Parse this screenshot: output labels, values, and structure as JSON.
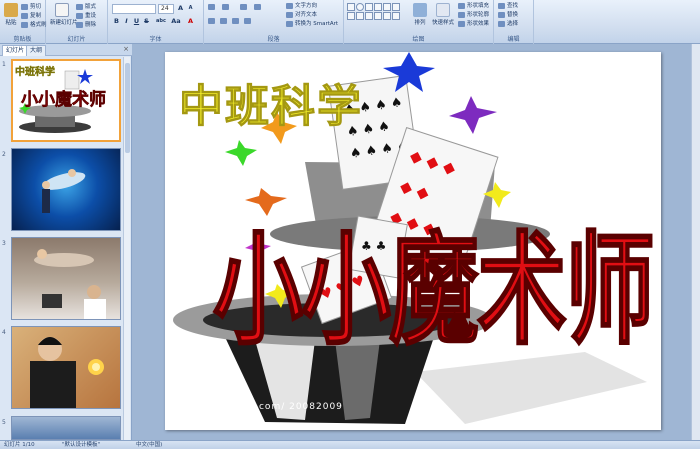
{
  "ribbon": {
    "clipboard": {
      "label": "剪贴板",
      "paste": "粘贴",
      "cut": "剪切",
      "copy": "复制",
      "format_painter": "格式刷"
    },
    "slides": {
      "label": "幻灯片",
      "new_slide": "新建幻灯片",
      "layout": "版式",
      "reset": "重设",
      "delete": "删除"
    },
    "font": {
      "label": "字体",
      "font_size": "24",
      "bold": "B",
      "italic": "I",
      "underline": "U",
      "strike": "S",
      "shadow": "abc",
      "aa": "Aa"
    },
    "paragraph": {
      "label": "段落",
      "text_direction": "文字方向",
      "align_text": "对齐文本",
      "smartart": "转换为 SmartArt"
    },
    "drawing": {
      "label": "绘图",
      "arrange": "排列",
      "quick_styles": "快速样式",
      "shape_fill": "形状填充",
      "shape_outline": "形状轮廓",
      "shape_effects": "形状效果"
    },
    "editing": {
      "label": "编辑",
      "find": "查找",
      "replace": "替换",
      "select": "选择"
    }
  },
  "panel": {
    "tabs": [
      "幻灯片",
      "大纲"
    ],
    "close": "×",
    "thumbs": [
      {
        "num": "1",
        "title": "中班科学",
        "subtitle": "小小魔术师"
      },
      {
        "num": "2"
      },
      {
        "num": "3"
      },
      {
        "num": "4"
      },
      {
        "num": "5"
      }
    ]
  },
  "slide": {
    "title": "中班科学",
    "subtitle": "小小魔术师",
    "watermark": "ZOOHOS  nipic.com/ 20082009"
  },
  "statusbar": {
    "slide_count": "幻灯片 1/10",
    "theme": "\"默认设计模板\"",
    "language": "中文(中国)"
  },
  "colors": {
    "title_yellow": "#f4ef2a",
    "subtitle_red": "#e10e13",
    "selection_orange": "#f2a23a"
  }
}
